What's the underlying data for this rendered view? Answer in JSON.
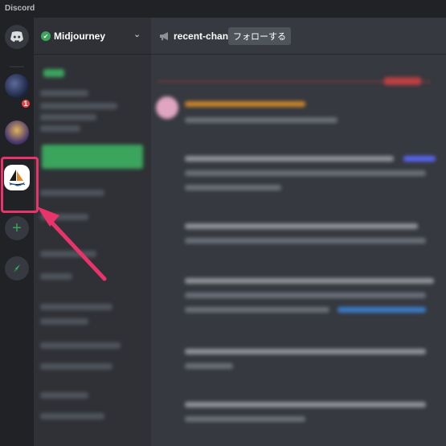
{
  "app": {
    "title": "Discord"
  },
  "server_rail": {
    "notification_count": "1",
    "add_symbol": "+"
  },
  "guild": {
    "name": "Midjourney",
    "chevron": "⌄"
  },
  "channel": {
    "name": "recent-changes",
    "follow_label": "フォローする"
  },
  "colors": {
    "accent_green": "#3ba55d",
    "highlight_pink": "#e8336b",
    "badge_red": "#ed4245",
    "background_dark": "#202225",
    "sidebar": "#2f3136",
    "main": "#36393f"
  },
  "icons": {
    "home": "discord-logo-icon",
    "add": "plus-icon",
    "explore": "compass-icon",
    "verified": "check-icon",
    "channel": "megaphone-icon",
    "pointer": "arrow-icon"
  }
}
